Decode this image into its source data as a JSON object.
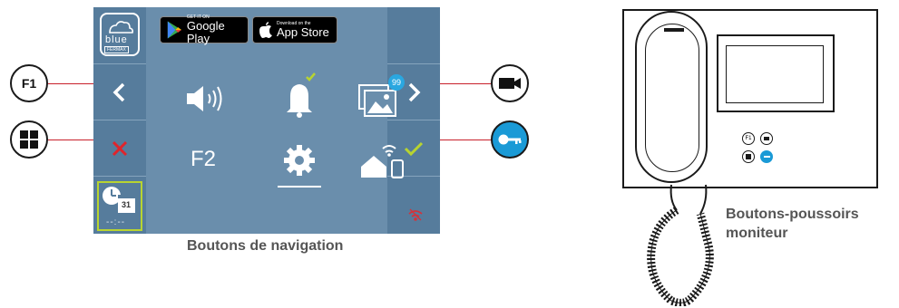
{
  "stores": {
    "google_small": "GET IT ON",
    "google_big": "Google Play",
    "apple_small": "Download on the",
    "apple_big": "App Store"
  },
  "logo": {
    "brand": "blue",
    "maker": "FERMAX"
  },
  "callouts": {
    "f1": "F1"
  },
  "menu": {
    "f2_label": "F2",
    "gallery_badge": "99"
  },
  "schedule": {
    "day": "31",
    "time": "--:--"
  },
  "captions": {
    "navigation": "Boutons de navigation",
    "monitor_line1": "Boutons-poussoirs",
    "monitor_line2": "moniteur"
  },
  "monitor": {
    "small_labels": [
      "F1",
      "",
      "",
      ""
    ]
  },
  "colors": {
    "screen_bg": "#6a8eac",
    "column_bg": "#567c9c",
    "cancel_red": "#e0242b",
    "accept_green": "#b8d430",
    "key_blue": "#1a9ad6"
  }
}
